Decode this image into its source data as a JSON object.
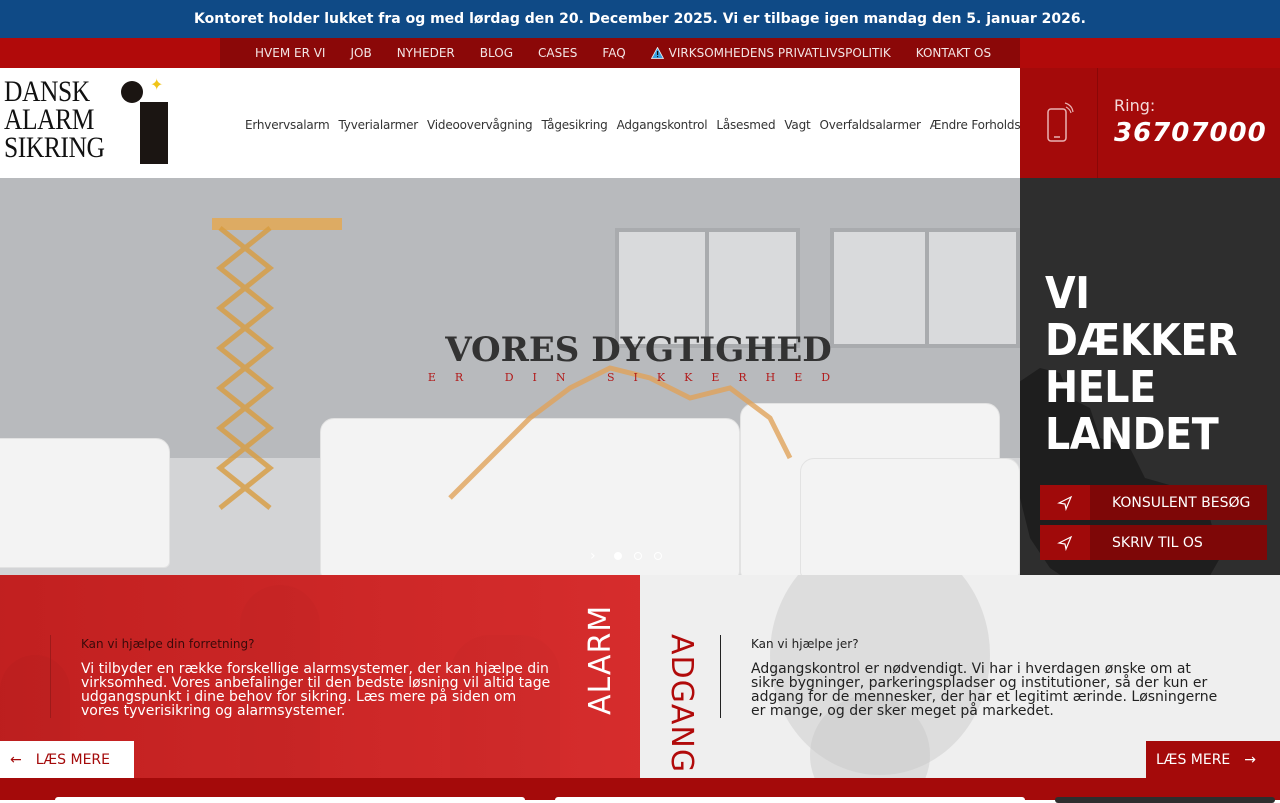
{
  "announcement": "Kontoret holder lukket fra og med lørdag den 20. December 2025. Vi er tilbage igen mandag den 5. januar 2026.",
  "top_nav": [
    {
      "label": "HVEM ER VI"
    },
    {
      "label": "JOB"
    },
    {
      "label": "NYHEDER"
    },
    {
      "label": "BLOG"
    },
    {
      "label": "CASES"
    },
    {
      "label": "FAQ"
    },
    {
      "label": "VIRKSOMHEDENS PRIVATLIVSPOLITIK",
      "icon": "warning-icon"
    },
    {
      "label": "KONTAKT OS"
    }
  ],
  "logo": {
    "line1": "DANSK",
    "line2": "ALARM",
    "line3": "SIKRING"
  },
  "main_nav": [
    "Erhvervsalarm",
    "Tyverialarmer",
    "Videoovervågning",
    "Tågesikring",
    "Adgangskontrol",
    "Låsesmed",
    "Vagt",
    "Overfaldsalarmer",
    "Ændre Forholdsordre"
  ],
  "phone": {
    "label": "Ring:",
    "number": "36707000",
    "icon": "mobile-phone-icon"
  },
  "hero": {
    "title": "VORES DYGTIGHED",
    "subtitle": "ER DIN SIKKERHED",
    "slides_count": 3,
    "active_slide": 1
  },
  "side": {
    "heading_lines": [
      "VI",
      "DÆKKER",
      "HELE",
      "LANDET"
    ],
    "buttons": [
      {
        "label": "KONSULENT BESØG",
        "icon": "send-arrow-icon"
      },
      {
        "label": "SKRIV TIL OS",
        "icon": "send-arrow-icon"
      }
    ]
  },
  "alarm": {
    "kicker": "Kan vi hjælpe din forretning?",
    "body": "Vi tilbyder en række forskellige alarmsystemer, der kan hjælpe din virksomhed. Vores anbefalinger til den bedste løsning vil altid tage udgangspunkt i dine behov for sikring. Læs mere på siden om vores tyverisikring og alarmsystemer.",
    "vertical_label": "ALARM",
    "more": "LÆS MERE",
    "arrow": "←"
  },
  "adgang": {
    "kicker": "Kan vi hjælpe jer?",
    "body": "Adgangskontrol er nødvendigt. Vi har i hverdagen ønske om at sikre bygninger, parkeringspladser og institutioner, så der kun er adgang for de mennesker, der har et legitimt ærinde. Løsningerne er mange, og der sker meget på markedet.",
    "vertical_label": "ADGANG",
    "more": "LÆS MERE",
    "arrow": "→"
  },
  "colors": {
    "announcement_bg": "#0f4a86",
    "brand_red": "#a40a0a",
    "dark_red": "#8b0808",
    "side_dark": "#2e2e2e"
  }
}
